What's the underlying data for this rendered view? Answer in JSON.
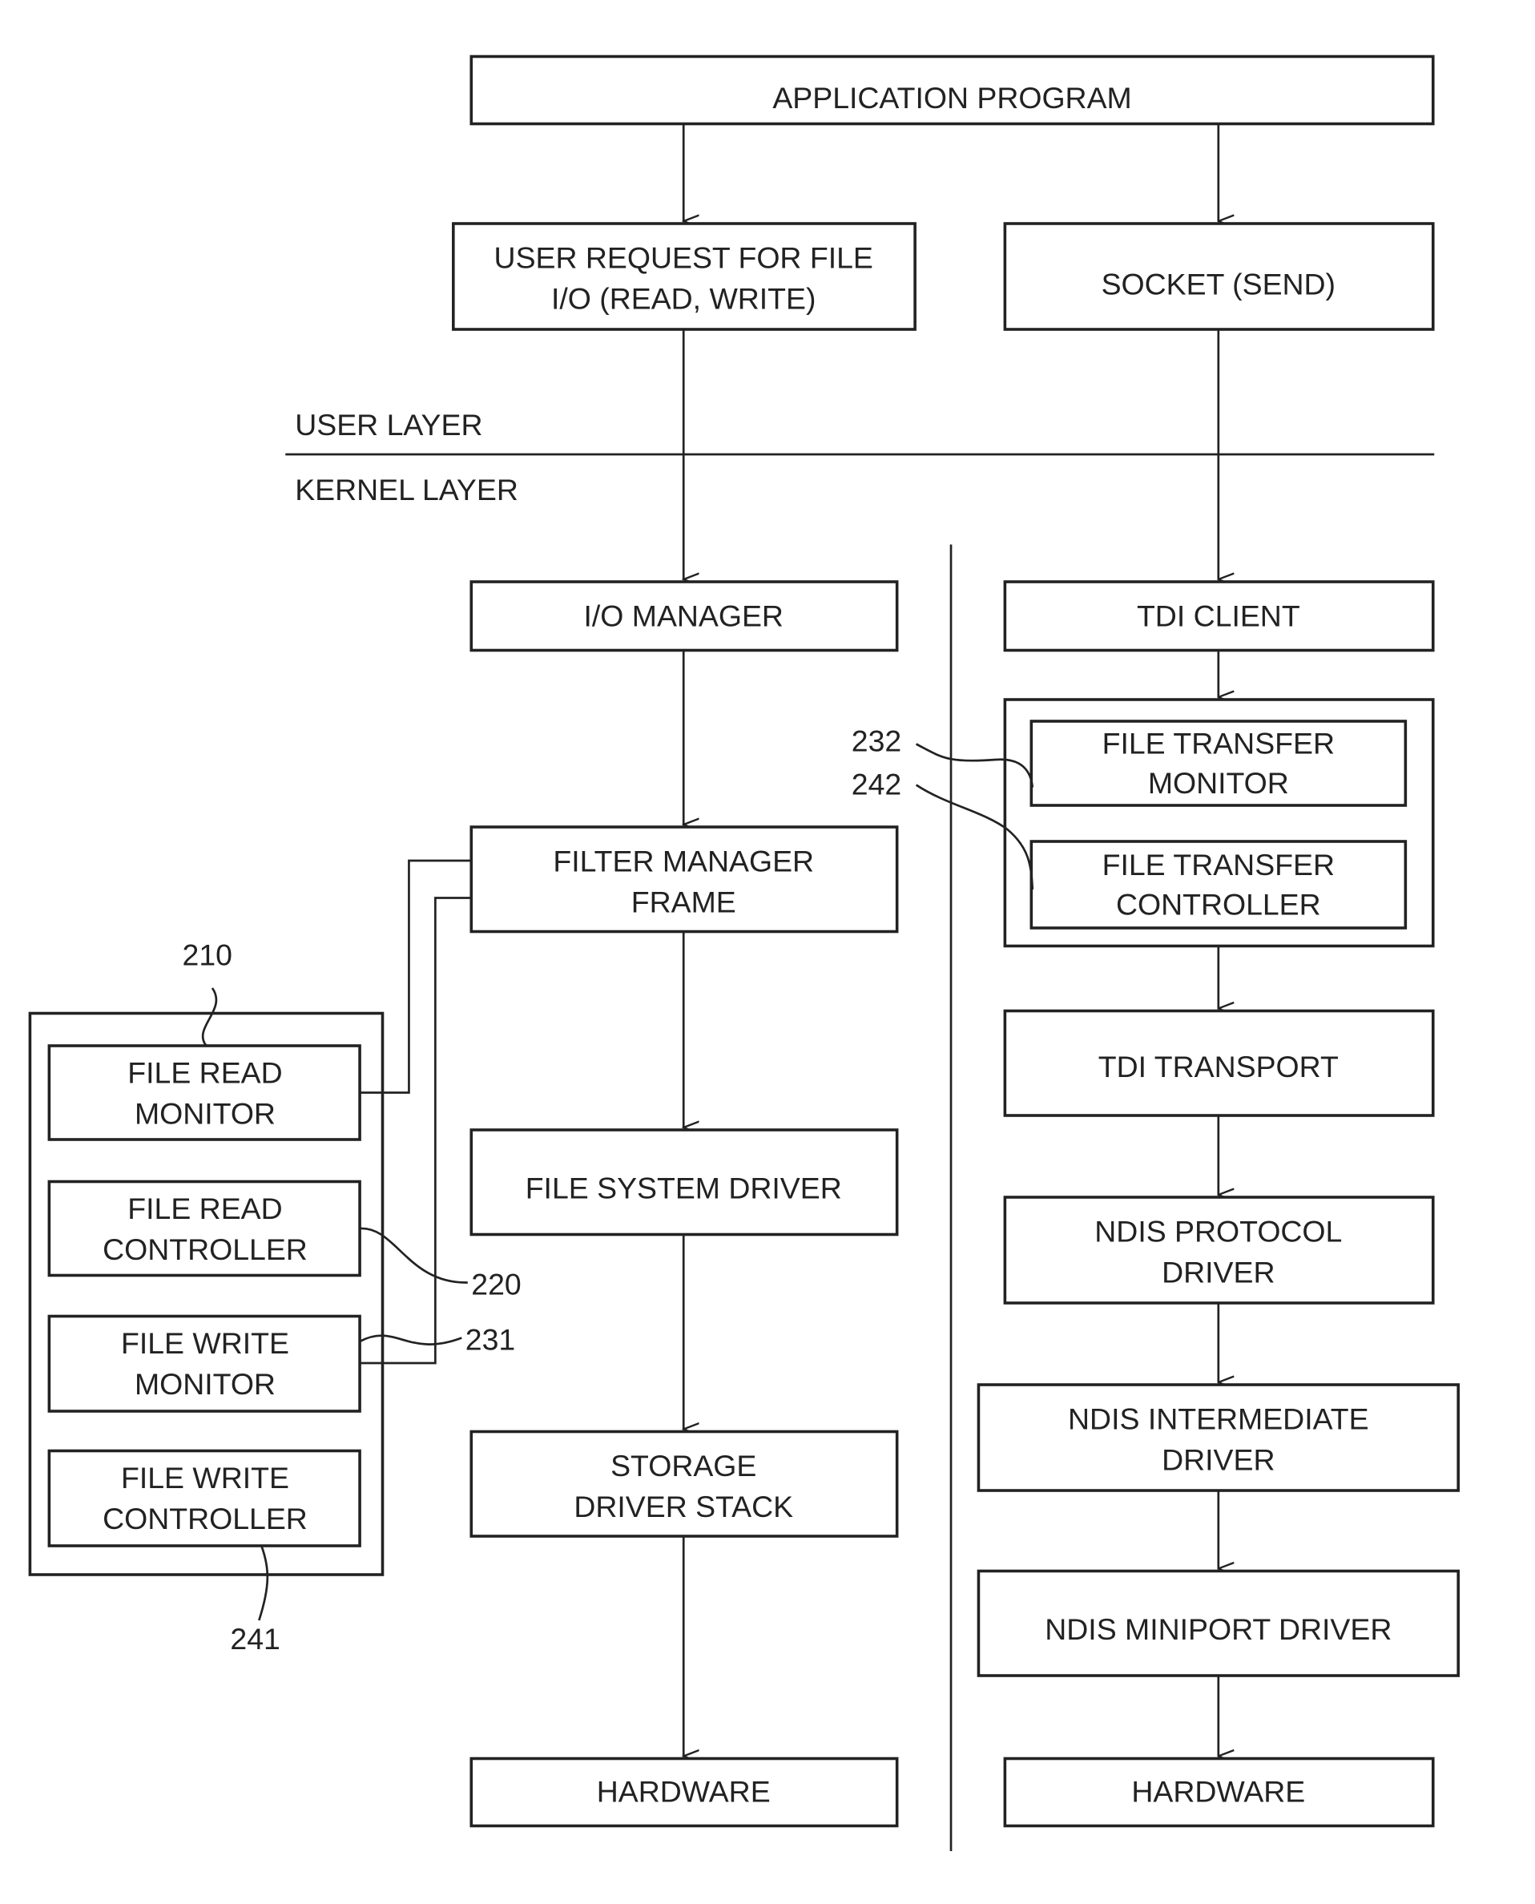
{
  "diagram": {
    "layers": {
      "user": "USER LAYER",
      "kernel": "KERNEL LAYER"
    },
    "boxes": {
      "application": [
        "APPLICATION PROGRAM"
      ],
      "user_request": [
        "USER REQUEST FOR FILE",
        "I/O (READ, WRITE)"
      ],
      "socket": [
        "SOCKET (SEND)"
      ],
      "io_manager": [
        "I/O MANAGER"
      ],
      "filter_manager": [
        "FILTER MANAGER",
        "FRAME"
      ],
      "file_system_driver": [
        "FILE SYSTEM DRIVER"
      ],
      "storage_driver": [
        "STORAGE",
        "DRIVER STACK"
      ],
      "hardware_left": [
        "HARDWARE"
      ],
      "tdi_client": [
        "TDI CLIENT"
      ],
      "file_transfer_monitor": [
        "FILE TRANSFER",
        "MONITOR"
      ],
      "file_transfer_controller": [
        "FILE TRANSFER",
        "CONTROLLER"
      ],
      "tdi_transport": [
        "TDI TRANSPORT"
      ],
      "ndis_protocol": [
        "NDIS PROTOCOL",
        "DRIVER"
      ],
      "ndis_intermediate": [
        "NDIS INTERMEDIATE",
        "DRIVER"
      ],
      "ndis_miniport": [
        "NDIS MINIPORT DRIVER"
      ],
      "hardware_right": [
        "HARDWARE"
      ],
      "file_read_monitor": [
        "FILE READ",
        "MONITOR"
      ],
      "file_read_controller": [
        "FILE READ",
        "CONTROLLER"
      ],
      "file_write_monitor": [
        "FILE WRITE",
        "MONITOR"
      ],
      "file_write_controller": [
        "FILE WRITE",
        "CONTROLLER"
      ]
    },
    "refs": {
      "r210": "210",
      "r220": "220",
      "r231": "231",
      "r241": "241",
      "r232": "232",
      "r242": "242"
    }
  }
}
